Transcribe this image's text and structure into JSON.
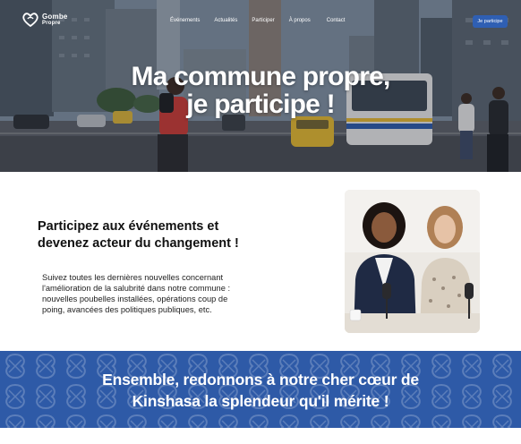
{
  "header": {
    "logo": {
      "line1": "Gombe",
      "line2": "Propre"
    },
    "nav": [
      {
        "label": "Événements"
      },
      {
        "label": "Actualités"
      },
      {
        "label": "Participer"
      },
      {
        "label": "À propos"
      },
      {
        "label": "Contact"
      }
    ],
    "cta_label": "Je participe"
  },
  "hero": {
    "title_line1": "Ma commune propre,",
    "title_line2": "je participe !"
  },
  "intro": {
    "heading_line1": "Participez aux événements et",
    "heading_line2": "devenez acteur du changement !",
    "body_lines": [
      "Suivez toutes les dernières nouvelles concernant",
      "l'amélioration de la salubrité dans notre commune :",
      "nouvelles poubelles installées, opérations coup de",
      "poing, avancées des politiques publiques, etc."
    ]
  },
  "band": {
    "line1": "Ensemble, redonnons à notre cher cœur de",
    "line2": "Kinshasa la splendeur qu'il mérite !"
  },
  "colors": {
    "brand_blue": "#2e5aa7",
    "cta_blue": "#2f5fb3"
  }
}
